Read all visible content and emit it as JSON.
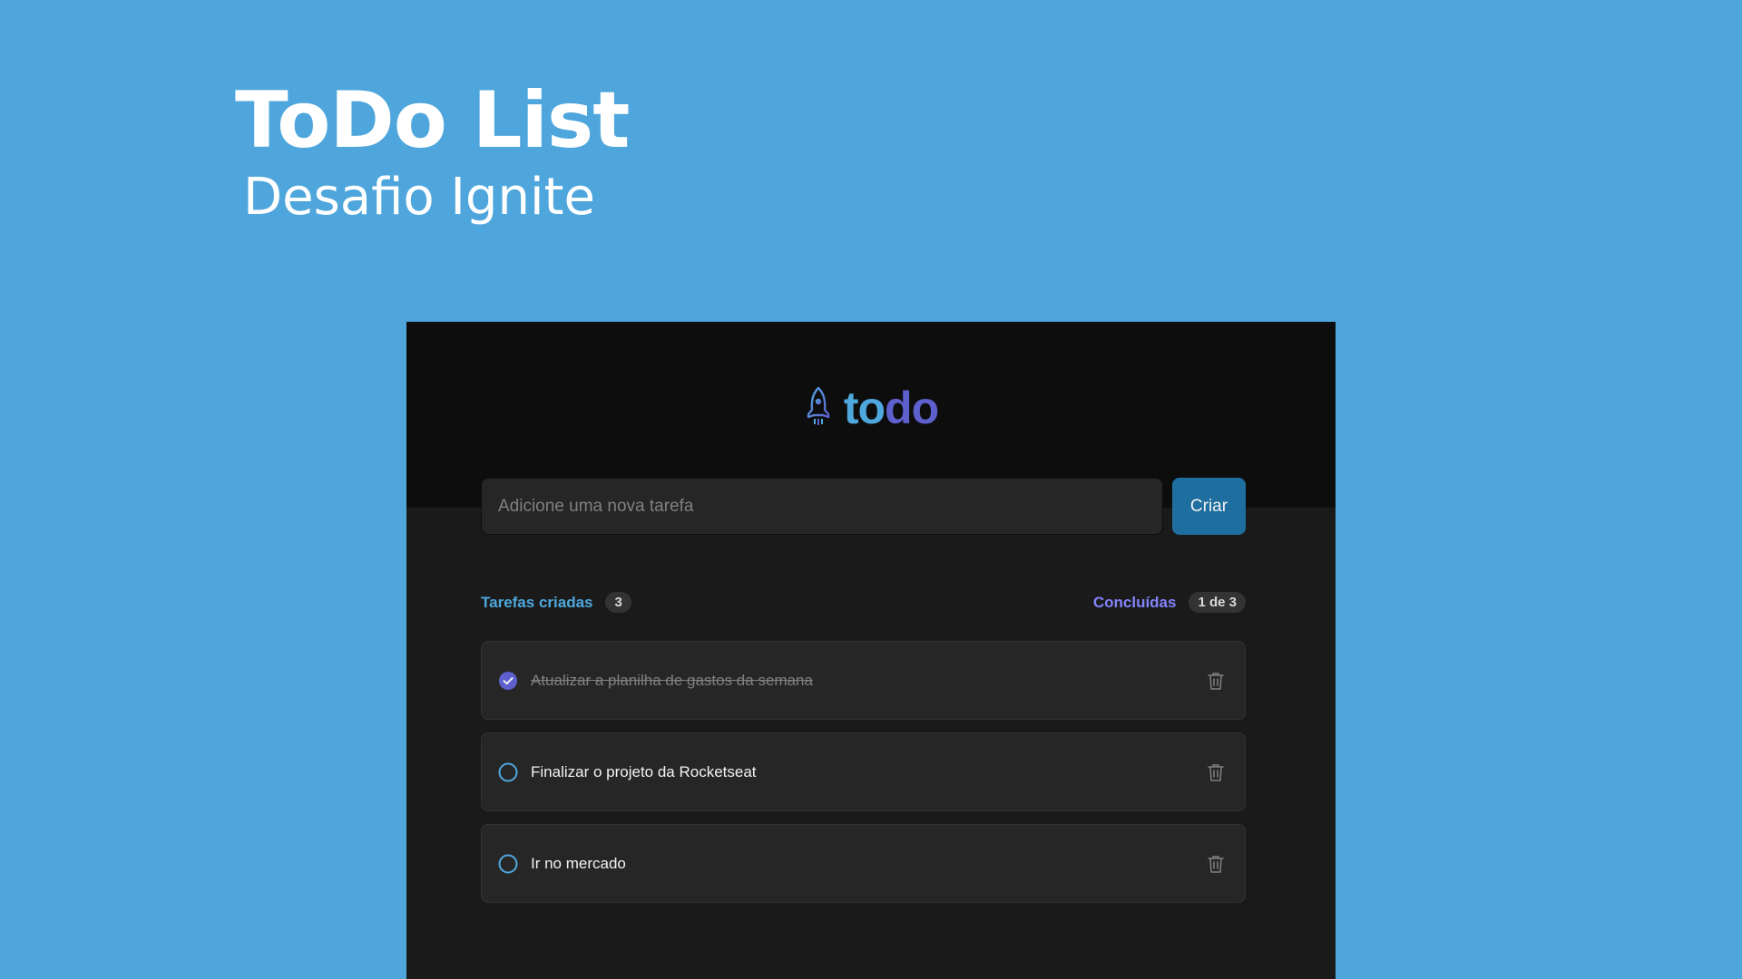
{
  "hero": {
    "title": "ToDo List",
    "subtitle": "Desafio Ignite"
  },
  "app": {
    "logo": {
      "part1": "to",
      "part2": "do",
      "icon": "rocket-icon"
    },
    "form": {
      "placeholder": "Adicione uma nova tarefa",
      "value": "",
      "create_label": "Criar"
    },
    "counters": {
      "created_label": "Tarefas criadas",
      "created_count": "3",
      "done_label": "Concluídas",
      "done_count": "1 de 3"
    },
    "tasks": [
      {
        "text": "Atualizar a planilha de gastos da semana",
        "done": true
      },
      {
        "text": "Finalizar o projeto da Rocketseat",
        "done": false
      },
      {
        "text": "Ir no mercado",
        "done": false
      }
    ]
  },
  "colors": {
    "background": "#4ea6dc",
    "app_header": "#0d0d0d",
    "app_body": "#1a1a1a",
    "blue": "#4ea8de",
    "blue_dark": "#1e6f9f",
    "purple": "#5e60ce",
    "purple_light": "#8284fa",
    "card": "#262626",
    "muted": "#808080"
  }
}
